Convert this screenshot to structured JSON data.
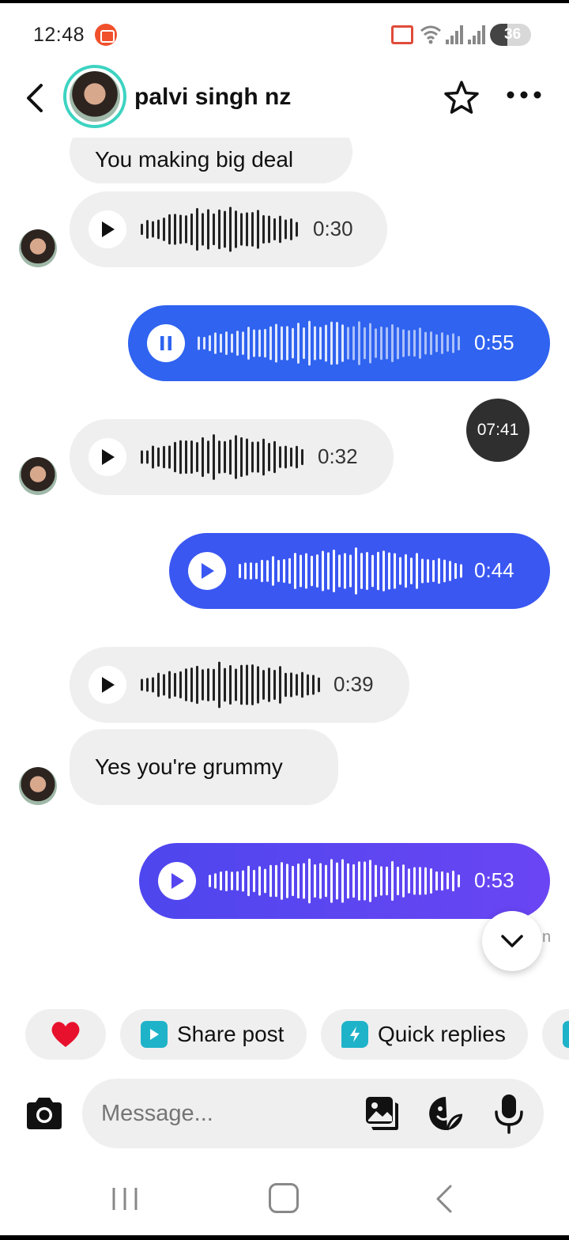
{
  "status_bar": {
    "time": "12:48",
    "battery_level": "36",
    "icons": [
      "screen-record-icon",
      "cast-icon",
      "wifi-icon",
      "signal-icon",
      "signal-icon",
      "battery-icon"
    ]
  },
  "header": {
    "contact_name": "palvi singh nz",
    "icons": [
      "back-arrow-icon",
      "avatar",
      "star-icon",
      "more-icon"
    ]
  },
  "messages": {
    "m1": {
      "sender": "contact",
      "text": "You making big deal"
    },
    "m2": {
      "sender": "contact",
      "type": "voice",
      "duration": "0:30",
      "state": "paused"
    },
    "m3": {
      "sender": "me",
      "type": "voice",
      "duration": "0:55",
      "state": "playing"
    },
    "m4": {
      "sender": "contact",
      "type": "voice",
      "duration": "0:32",
      "state": "paused"
    },
    "m5": {
      "sender": "me",
      "type": "voice",
      "duration": "0:44",
      "state": "paused"
    },
    "m6": {
      "sender": "contact",
      "type": "voice",
      "duration": "0:39",
      "state": "paused"
    },
    "m7": {
      "sender": "contact",
      "text": "Yes you're grummy"
    },
    "m8": {
      "sender": "me",
      "type": "voice",
      "duration": "0:53",
      "state": "paused"
    }
  },
  "time_badge": "07:41",
  "seen_fragment": "n",
  "quick_actions": {
    "heart": "heart-icon",
    "share_post": "Share post",
    "quick_replies": "Quick replies"
  },
  "composer": {
    "placeholder": "Message...",
    "icons": [
      "camera-icon",
      "gallery-icon",
      "sticker-icon",
      "mic-icon"
    ]
  },
  "colors": {
    "outgoing_1": "#2f63f0",
    "outgoing_2": "#3a57f2",
    "outgoing_3": "#6045f0",
    "incoming": "#efefef",
    "avatar_ring": "#3dd3c1",
    "chip_icon": "#1fb3c9",
    "heart": "#e8112d"
  }
}
